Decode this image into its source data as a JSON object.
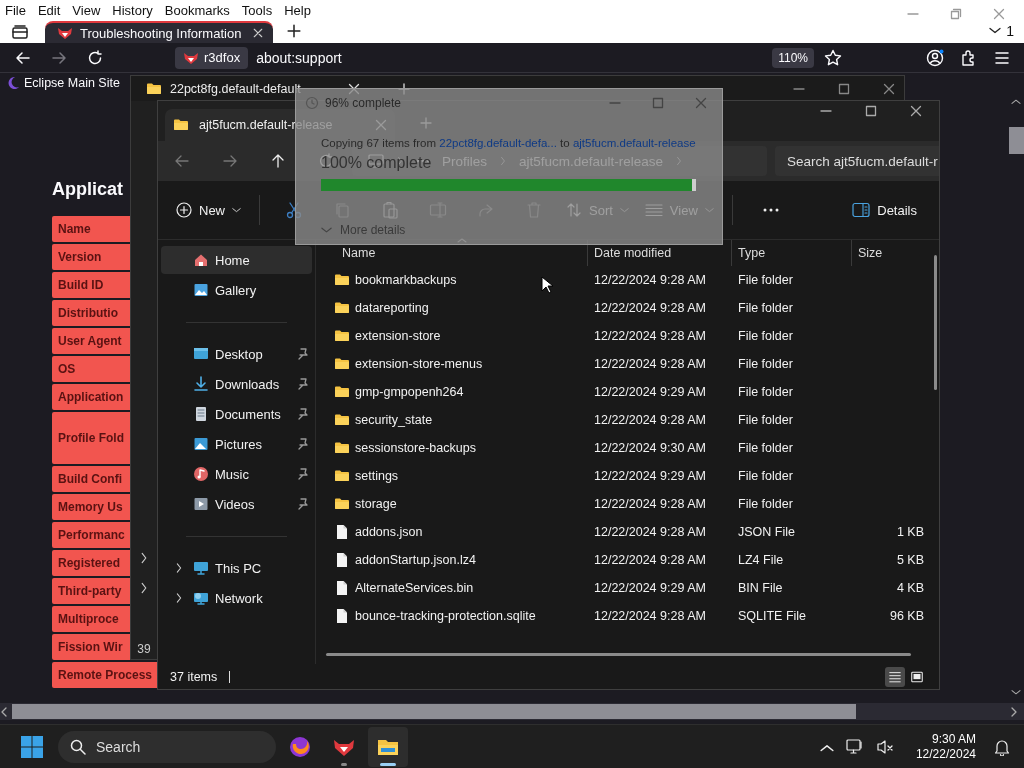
{
  "browser": {
    "menu": [
      "File",
      "Edit",
      "View",
      "History",
      "Bookmarks",
      "Tools",
      "Help"
    ],
    "tab_count": "1",
    "tabs": [
      {
        "title": "Troubleshooting Information",
        "selected": true
      }
    ],
    "identity": "r3dfox",
    "url": "about:support",
    "zoom": "110%",
    "bookmarks": [
      "Eclipse Main Site"
    ]
  },
  "page": {
    "heading": "Applicat",
    "rows": [
      {
        "label": "Name",
        "kind": "normal"
      },
      {
        "label": "Version",
        "kind": "normal"
      },
      {
        "label": "Build ID",
        "kind": "normal"
      },
      {
        "label": "Distributio",
        "kind": "normal"
      },
      {
        "label": "User Agent",
        "kind": "normal"
      },
      {
        "label": "OS",
        "kind": "normal"
      },
      {
        "label": "Application",
        "kind": "normal"
      },
      {
        "label": "Profile Fold",
        "kind": "tall"
      },
      {
        "label": "Build Confi",
        "kind": "normal"
      },
      {
        "label": "Memory Us",
        "kind": "normal"
      },
      {
        "label": "Performanc",
        "kind": "normal"
      },
      {
        "label": "Registered",
        "kind": "normal"
      },
      {
        "label": "Third-party",
        "kind": "normal"
      },
      {
        "label": "Multiproce",
        "kind": "normal"
      },
      {
        "label": "Fission Wir",
        "kind": "normal"
      },
      {
        "label": "Remote Process",
        "kind": "normal"
      }
    ]
  },
  "back_window": {
    "title": "22pct8fg.default-default",
    "status": "39"
  },
  "explorer": {
    "tab": "ajt5fucm.default-release",
    "breadcrumb": [
      "Profiles",
      "ajt5fucm.default-release"
    ],
    "search": {
      "placeholder": "Search ajt5fucm.default-r"
    },
    "commands": {
      "new": "New",
      "sort": "Sort",
      "view": "View",
      "details": "Details"
    },
    "sidebar": [
      {
        "label": "Home",
        "kind": "home",
        "selected": true,
        "pinned": false
      },
      {
        "label": "Gallery",
        "kind": "gallery",
        "selected": false,
        "pinned": false
      },
      {
        "kind": "divider"
      },
      {
        "label": "Desktop",
        "kind": "desktop",
        "selected": false,
        "pinned": true
      },
      {
        "label": "Downloads",
        "kind": "downloads",
        "selected": false,
        "pinned": true
      },
      {
        "label": "Documents",
        "kind": "documents",
        "selected": false,
        "pinned": true
      },
      {
        "label": "Pictures",
        "kind": "pictures",
        "selected": false,
        "pinned": true
      },
      {
        "label": "Music",
        "kind": "music",
        "selected": false,
        "pinned": true
      },
      {
        "label": "Videos",
        "kind": "videos",
        "selected": false,
        "pinned": true
      },
      {
        "kind": "divider"
      },
      {
        "label": "This PC",
        "kind": "pc",
        "selected": false,
        "pinned": false,
        "expanded": false
      },
      {
        "label": "Network",
        "kind": "network",
        "selected": false,
        "pinned": false,
        "expanded": false
      }
    ],
    "columns": [
      "Name",
      "Date modified",
      "Type",
      "Size"
    ],
    "rows": [
      {
        "name": "bookmarkbackups",
        "date": "12/22/2024 9:28 AM",
        "type": "File folder",
        "kind": "folder"
      },
      {
        "name": "datareporting",
        "date": "12/22/2024 9:28 AM",
        "type": "File folder",
        "kind": "folder"
      },
      {
        "name": "extension-store",
        "date": "12/22/2024 9:28 AM",
        "type": "File folder",
        "kind": "folder"
      },
      {
        "name": "extension-store-menus",
        "date": "12/22/2024 9:28 AM",
        "type": "File folder",
        "kind": "folder"
      },
      {
        "name": "gmp-gmpopenh264",
        "date": "12/22/2024 9:29 AM",
        "type": "File folder",
        "kind": "folder"
      },
      {
        "name": "security_state",
        "date": "12/22/2024 9:28 AM",
        "type": "File folder",
        "kind": "folder"
      },
      {
        "name": "sessionstore-backups",
        "date": "12/22/2024 9:30 AM",
        "type": "File folder",
        "kind": "folder"
      },
      {
        "name": "settings",
        "date": "12/22/2024 9:29 AM",
        "type": "File folder",
        "kind": "folder"
      },
      {
        "name": "storage",
        "date": "12/22/2024 9:28 AM",
        "type": "File folder",
        "kind": "folder"
      },
      {
        "name": "addons.json",
        "date": "12/22/2024 9:28 AM",
        "type": "JSON File",
        "size": "1 KB",
        "kind": "file"
      },
      {
        "name": "addonStartup.json.lz4",
        "date": "12/22/2024 9:28 AM",
        "type": "LZ4 File",
        "size": "5 KB",
        "kind": "file"
      },
      {
        "name": "AlternateServices.bin",
        "date": "12/22/2024 9:29 AM",
        "type": "BIN File",
        "size": "4 KB",
        "kind": "file"
      },
      {
        "name": "bounce-tracking-protection.sqlite",
        "date": "12/22/2024 9:28 AM",
        "type": "SQLITE File",
        "size": "96 KB",
        "kind": "file"
      }
    ],
    "status": "37 items",
    "views": [
      {
        "kind": "details",
        "selected": true
      },
      {
        "kind": "tiles",
        "selected": false
      }
    ]
  },
  "copy_dialog": {
    "title": "96% complete",
    "message_start": "Copying 67 items from ",
    "source": "22pct8fg.default-defa...",
    "message_mid": " to ",
    "target": "ajt5fucm.default-release",
    "progress_text": "100% complete",
    "level": 0.99,
    "more": "More details"
  },
  "taskbar": {
    "search": "Search",
    "apps": [
      {
        "kind": "firefox",
        "running": false,
        "selected": false
      },
      {
        "kind": "r3dfox",
        "running": true,
        "selected": false
      },
      {
        "kind": "explorer",
        "running": true,
        "selected": true
      }
    ],
    "time": "9:30 AM",
    "date": "12/22/2024"
  }
}
